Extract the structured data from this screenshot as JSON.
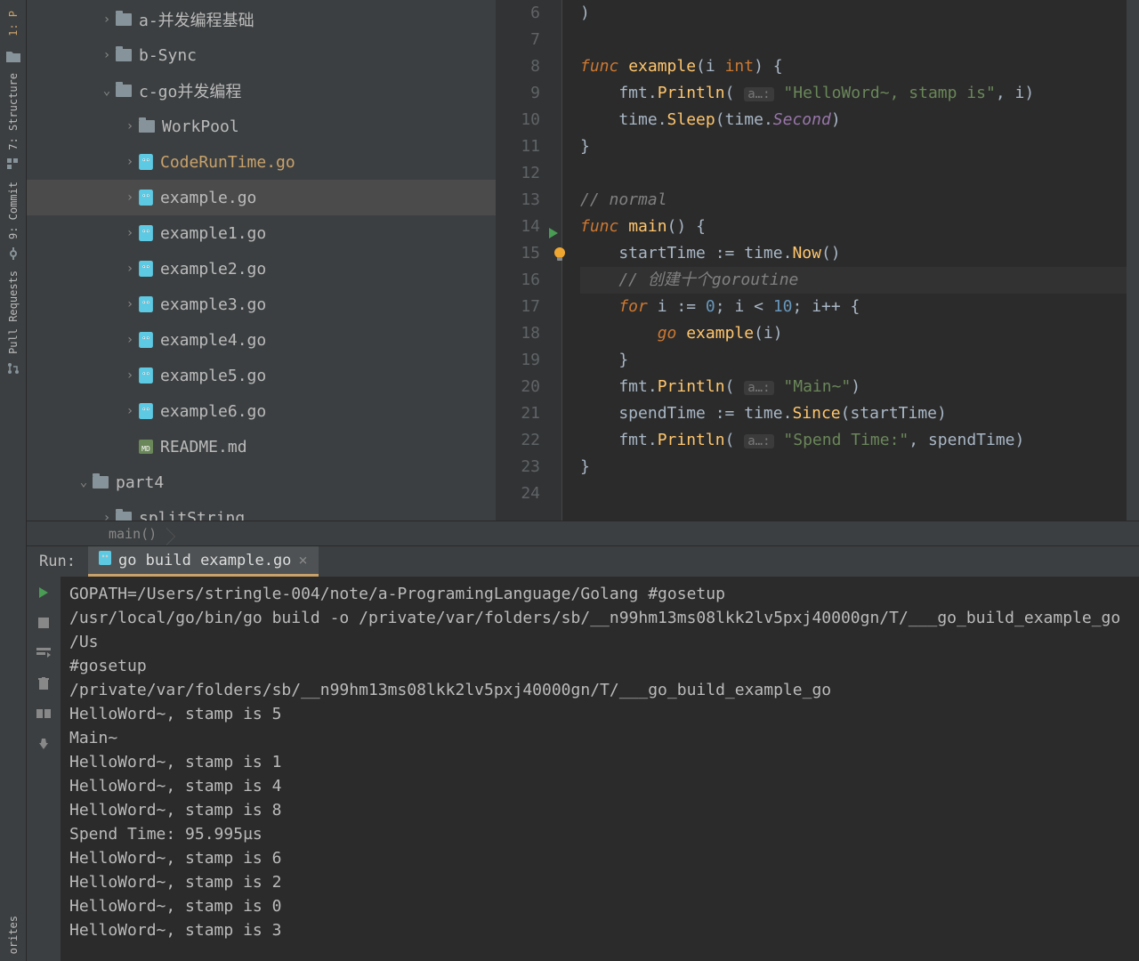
{
  "leftRail": {
    "items": [
      "1: P",
      "7: Structure",
      "9: Commit",
      "Pull Requests",
      "orites"
    ]
  },
  "tree": {
    "items": [
      {
        "indent": 80,
        "chev": "›",
        "type": "folder",
        "label": "a-并发编程基础"
      },
      {
        "indent": 80,
        "chev": "›",
        "type": "folder",
        "label": "b-Sync"
      },
      {
        "indent": 80,
        "chev": "⌄",
        "type": "folder",
        "label": "c-go并发编程"
      },
      {
        "indent": 106,
        "chev": "›",
        "type": "folder",
        "label": "WorkPool"
      },
      {
        "indent": 106,
        "chev": "›",
        "type": "go",
        "label": "CodeRunTime.go",
        "hl": true
      },
      {
        "indent": 106,
        "chev": "›",
        "type": "go",
        "label": "example.go",
        "selected": true
      },
      {
        "indent": 106,
        "chev": "›",
        "type": "go",
        "label": "example1.go"
      },
      {
        "indent": 106,
        "chev": "›",
        "type": "go",
        "label": "example2.go"
      },
      {
        "indent": 106,
        "chev": "›",
        "type": "go",
        "label": "example3.go"
      },
      {
        "indent": 106,
        "chev": "›",
        "type": "go",
        "label": "example4.go"
      },
      {
        "indent": 106,
        "chev": "›",
        "type": "go",
        "label": "example5.go"
      },
      {
        "indent": 106,
        "chev": "›",
        "type": "go",
        "label": "example6.go"
      },
      {
        "indent": 106,
        "chev": "",
        "type": "md",
        "label": "README.md"
      },
      {
        "indent": 54,
        "chev": "⌄",
        "type": "folder",
        "label": "part4"
      },
      {
        "indent": 80,
        "chev": "›",
        "type": "folder",
        "label": "splitString"
      }
    ]
  },
  "editor": {
    "startLine": 6,
    "lines": [
      {
        "n": 6,
        "tokens": [
          [
            "paren",
            ")"
          ]
        ]
      },
      {
        "n": 7,
        "tokens": []
      },
      {
        "n": 8,
        "tokens": [
          [
            "kw",
            "func "
          ],
          [
            "fn",
            "example"
          ],
          [
            "paren",
            "("
          ],
          [
            "ident",
            "i "
          ],
          [
            "typ",
            "int"
          ],
          [
            "paren",
            ")"
          ],
          [
            "op",
            " {"
          ]
        ]
      },
      {
        "n": 9,
        "tokens": [
          [
            "pkg",
            "    fmt"
          ],
          [
            "op",
            "."
          ],
          [
            "fn",
            "Println"
          ],
          [
            "paren",
            "( "
          ],
          [
            "hint",
            "a…:"
          ],
          [
            "op",
            " "
          ],
          [
            "str",
            "\"HelloWord~, stamp is\""
          ],
          [
            "op",
            ", "
          ],
          [
            "ident",
            "i"
          ],
          [
            "paren",
            ")"
          ]
        ]
      },
      {
        "n": 10,
        "tokens": [
          [
            "pkg",
            "    time"
          ],
          [
            "op",
            "."
          ],
          [
            "fn",
            "Sleep"
          ],
          [
            "paren",
            "("
          ],
          [
            "pkg",
            "time"
          ],
          [
            "op",
            "."
          ],
          [
            "const",
            "Second"
          ],
          [
            "paren",
            ")"
          ]
        ]
      },
      {
        "n": 11,
        "tokens": [
          [
            "op",
            "}"
          ]
        ]
      },
      {
        "n": 12,
        "tokens": []
      },
      {
        "n": 13,
        "tokens": [
          [
            "com",
            "// normal"
          ]
        ]
      },
      {
        "n": 14,
        "tokens": [
          [
            "kw",
            "func "
          ],
          [
            "fn",
            "main"
          ],
          [
            "paren",
            "()"
          ],
          [
            "op",
            " {"
          ]
        ],
        "run": true
      },
      {
        "n": 15,
        "tokens": [
          [
            "ident",
            "    startTime "
          ],
          [
            "op",
            ":= "
          ],
          [
            "pkg",
            "time"
          ],
          [
            "op",
            "."
          ],
          [
            "fn",
            "Now"
          ],
          [
            "paren",
            "()"
          ]
        ],
        "bulb": true
      },
      {
        "n": 16,
        "tokens": [
          [
            "com",
            "    // 创建十个goroutine"
          ]
        ],
        "hl": true
      },
      {
        "n": 17,
        "tokens": [
          [
            "kw",
            "    for "
          ],
          [
            "ident",
            "i "
          ],
          [
            "op",
            ":= "
          ],
          [
            "num",
            "0"
          ],
          [
            "op",
            "; "
          ],
          [
            "ident",
            "i "
          ],
          [
            "op",
            "< "
          ],
          [
            "num",
            "10"
          ],
          [
            "op",
            "; "
          ],
          [
            "ident",
            "i"
          ],
          [
            "op",
            "++ {"
          ]
        ]
      },
      {
        "n": 18,
        "tokens": [
          [
            "kw",
            "        go "
          ],
          [
            "fn",
            "example"
          ],
          [
            "paren",
            "("
          ],
          [
            "ident",
            "i"
          ],
          [
            "paren",
            ")"
          ]
        ]
      },
      {
        "n": 19,
        "tokens": [
          [
            "op",
            "    }"
          ]
        ]
      },
      {
        "n": 20,
        "tokens": [
          [
            "pkg",
            "    fmt"
          ],
          [
            "op",
            "."
          ],
          [
            "fn",
            "Println"
          ],
          [
            "paren",
            "( "
          ],
          [
            "hint",
            "a…:"
          ],
          [
            "op",
            " "
          ],
          [
            "str",
            "\"Main~\""
          ],
          [
            "paren",
            ")"
          ]
        ]
      },
      {
        "n": 21,
        "tokens": [
          [
            "ident",
            "    spendTime "
          ],
          [
            "op",
            ":= "
          ],
          [
            "pkg",
            "time"
          ],
          [
            "op",
            "."
          ],
          [
            "fn",
            "Since"
          ],
          [
            "paren",
            "("
          ],
          [
            "ident",
            "startTime"
          ],
          [
            "paren",
            ")"
          ]
        ]
      },
      {
        "n": 22,
        "tokens": [
          [
            "pkg",
            "    fmt"
          ],
          [
            "op",
            "."
          ],
          [
            "fn",
            "Println"
          ],
          [
            "paren",
            "( "
          ],
          [
            "hint",
            "a…:"
          ],
          [
            "op",
            " "
          ],
          [
            "str",
            "\"Spend Time:\""
          ],
          [
            "op",
            ", "
          ],
          [
            "ident",
            "spendTime"
          ],
          [
            "paren",
            ")"
          ]
        ]
      },
      {
        "n": 23,
        "tokens": [
          [
            "op",
            "}"
          ]
        ]
      },
      {
        "n": 24,
        "tokens": []
      }
    ],
    "breadcrumb": "main()"
  },
  "run": {
    "label": "Run:",
    "tab": "go build example.go",
    "output": [
      "GOPATH=/Users/stringle-004/note/a-ProgramingLanguage/Golang #gosetup",
      "/usr/local/go/bin/go build -o /private/var/folders/sb/__n99hm13ms08lkk2lv5pxj40000gn/T/___go_build_example_go /Us",
      "#gosetup",
      "/private/var/folders/sb/__n99hm13ms08lkk2lv5pxj40000gn/T/___go_build_example_go",
      "HelloWord~, stamp is 5",
      "Main~",
      "HelloWord~, stamp is 1",
      "HelloWord~, stamp is 4",
      "HelloWord~, stamp is 8",
      "Spend Time: 95.995µs",
      "HelloWord~, stamp is 6",
      "HelloWord~, stamp is 2",
      "HelloWord~, stamp is 0",
      "HelloWord~, stamp is 3"
    ]
  }
}
